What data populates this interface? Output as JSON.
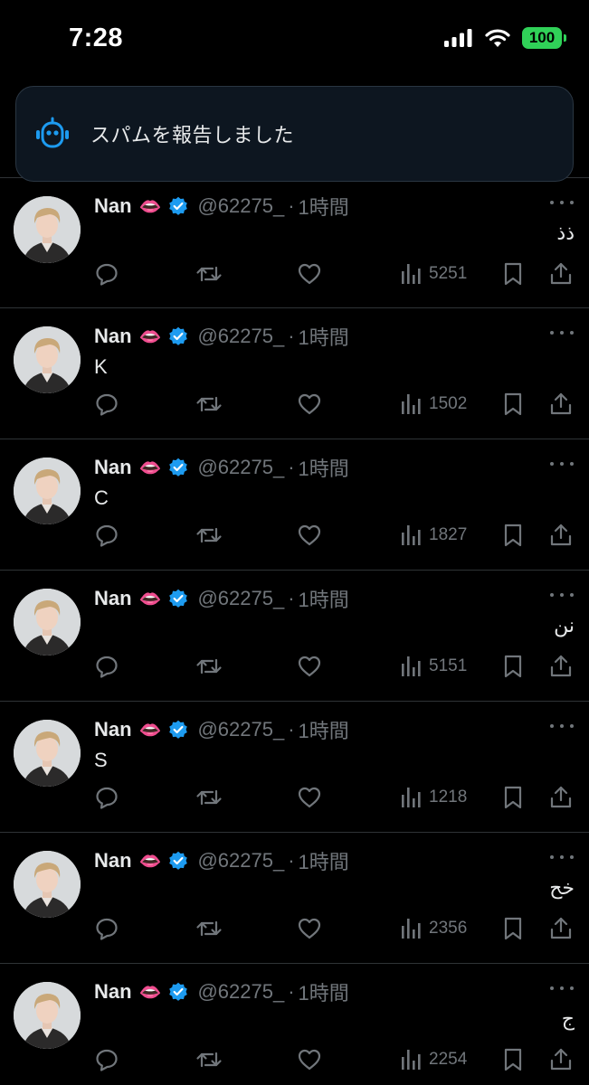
{
  "status_bar": {
    "time": "7:28",
    "battery": "100",
    "battery_color": "#30d158"
  },
  "toast": {
    "icon": "robot-icon",
    "text": "スパムを報告しました"
  },
  "posts": [
    {
      "name": "Nan",
      "emoji": "👄",
      "handle": "@62275_",
      "separator": "·",
      "time": "1時間",
      "text": "ذذ",
      "views": "5251"
    },
    {
      "name": "Nan",
      "emoji": "👄",
      "handle": "@62275_",
      "separator": "·",
      "time": "1時間",
      "text": "K",
      "views": "1502"
    },
    {
      "name": "Nan",
      "emoji": "👄",
      "handle": "@62275_",
      "separator": "·",
      "time": "1時間",
      "text": "C",
      "views": "1827"
    },
    {
      "name": "Nan",
      "emoji": "👄",
      "handle": "@62275_",
      "separator": "·",
      "time": "1時間",
      "text": "نن",
      "views": "5151"
    },
    {
      "name": "Nan",
      "emoji": "👄",
      "handle": "@62275_",
      "separator": "·",
      "time": "1時間",
      "text": "S",
      "views": "1218"
    },
    {
      "name": "Nan",
      "emoji": "👄",
      "handle": "@62275_",
      "separator": "·",
      "time": "1時間",
      "text": "خح",
      "views": "2356"
    },
    {
      "name": "Nan",
      "emoji": "👄",
      "handle": "@62275_",
      "separator": "·",
      "time": "1時間",
      "text": "ج",
      "views": "2254"
    }
  ],
  "colors": {
    "background": "#000000",
    "muted": "#71767b",
    "verified": "#1d9bf0",
    "divider": "#2f3336"
  }
}
